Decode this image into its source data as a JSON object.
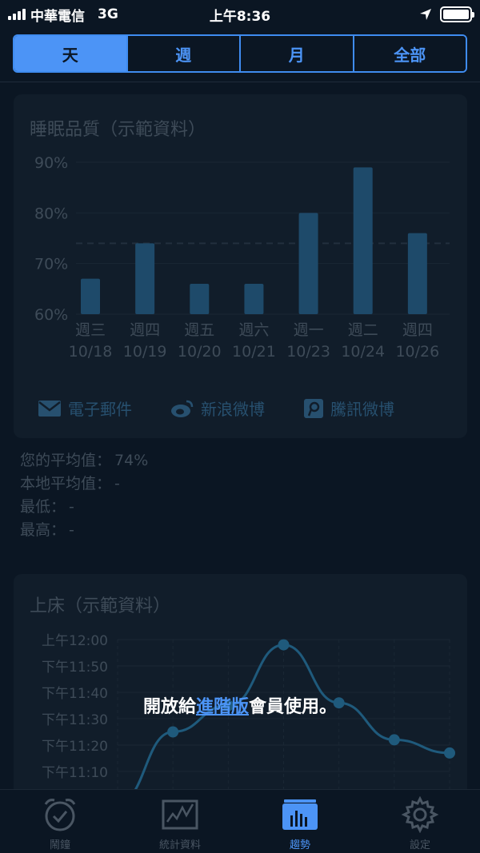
{
  "status": {
    "carrier": "中華電信",
    "network": "3G",
    "time": "上午8:36"
  },
  "segments": [
    {
      "label": "天",
      "active": true
    },
    {
      "label": "週",
      "active": false
    },
    {
      "label": "月",
      "active": false
    },
    {
      "label": "全部",
      "active": false
    }
  ],
  "sleep_card": {
    "title": "睡眠品質（示範資料）"
  },
  "share": {
    "email": "電子郵件",
    "sina": "新浪微博",
    "tencent": "騰訊微博"
  },
  "stats": {
    "your_avg_label": "您的平均值：",
    "your_avg_value": "74%",
    "local_avg_label": "本地平均值：",
    "local_avg_value": "-",
    "min_label": "最低：",
    "min_value": "-",
    "max_label": "最高：",
    "max_value": "-"
  },
  "bed_card": {
    "title": "上床（示範資料）"
  },
  "premium": {
    "before": "開放給",
    "link": "進階版",
    "after": "會員使用。"
  },
  "tabs": [
    {
      "label": "鬧鐘",
      "icon": "alarm-clock-icon",
      "active": false
    },
    {
      "label": "統計資料",
      "icon": "statistics-icon",
      "active": false
    },
    {
      "label": "趨勢",
      "icon": "trends-icon",
      "active": true
    },
    {
      "label": "設定",
      "icon": "gear-icon",
      "active": false
    }
  ],
  "colors": {
    "accent": "#4c94f6",
    "background": "#0b1623",
    "card": "#111d2a",
    "bar": "#1e4a6a"
  },
  "chart_data": [
    {
      "type": "bar",
      "title": "睡眠品質（示範資料）",
      "categories": [
        [
          "週三",
          "10/18"
        ],
        [
          "週四",
          "10/19"
        ],
        [
          "週五",
          "10/20"
        ],
        [
          "週六",
          "10/21"
        ],
        [
          "週一",
          "10/23"
        ],
        [
          "週二",
          "10/24"
        ],
        [
          "週四",
          "10/26"
        ]
      ],
      "values": [
        67,
        74,
        66,
        66,
        80,
        89,
        76
      ],
      "ylim": [
        60,
        90
      ],
      "yticks": [
        "90%",
        "80%",
        "70%",
        "60%"
      ],
      "average": 74
    },
    {
      "type": "line",
      "title": "上床（示範資料）",
      "yticks": [
        "上午12:00",
        "下午11:50",
        "下午11:40",
        "下午11:30",
        "下午11:20",
        "下午11:10"
      ],
      "ylim_minutes": [
        -60,
        0
      ],
      "values_minutes": [
        -62,
        -35,
        -25,
        -2,
        -24,
        -38,
        -43
      ]
    }
  ]
}
